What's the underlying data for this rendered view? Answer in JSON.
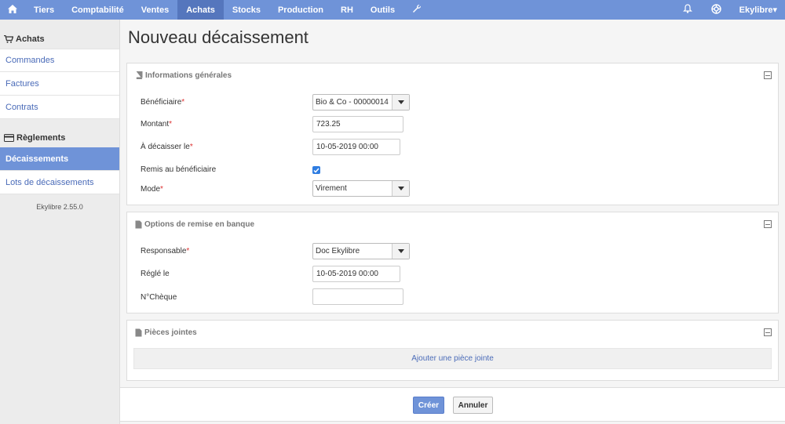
{
  "nav": {
    "items": [
      {
        "label": "Tiers"
      },
      {
        "label": "Comptabilité"
      },
      {
        "label": "Ventes"
      },
      {
        "label": "Achats"
      },
      {
        "label": "Stocks"
      },
      {
        "label": "Production"
      },
      {
        "label": "RH"
      },
      {
        "label": "Outils"
      }
    ],
    "active": "Achats",
    "user_label": "Ekylibre▾",
    "colors": {
      "bar": "#6f93d8",
      "active": "#5576bd"
    }
  },
  "sidebar": {
    "section1_title": "Achats",
    "section1_items": [
      {
        "label": "Commandes"
      },
      {
        "label": "Factures"
      },
      {
        "label": "Contrats"
      }
    ],
    "section2_title": "Règlements",
    "section2_items": [
      {
        "label": "Décaissements"
      },
      {
        "label": "Lots de décaissements"
      }
    ],
    "active": "Décaissements",
    "version": "Ekylibre 2.55.0"
  },
  "main": {
    "title": "Nouveau décaissement",
    "general": {
      "heading": "Informations générales",
      "beneficiary_label": "Bénéficiaire",
      "beneficiary_value": "Bio & Co - 00000014",
      "amount_label": "Montant",
      "amount_value": "723.25",
      "due_label": "À décaisser le",
      "due_value": "10-05-2019 00:00",
      "delivered_label": "Remis au bénéficiaire",
      "delivered_checked": true,
      "mode_label": "Mode",
      "mode_value": "Virement",
      "required_mark": "*"
    },
    "bank": {
      "heading": "Options de remise en banque",
      "responsible_label": "Responsable",
      "responsible_value": "Doc Ekylibre",
      "paid_label": "Réglé le",
      "paid_value": "10-05-2019 00:00",
      "cheque_label": "N°Chèque",
      "cheque_value": ""
    },
    "attachments": {
      "heading": "Pièces jointes",
      "add_label": "Ajouter une pièce jointe"
    },
    "actions": {
      "create_label": "Créer",
      "cancel_label": "Annuler"
    }
  }
}
